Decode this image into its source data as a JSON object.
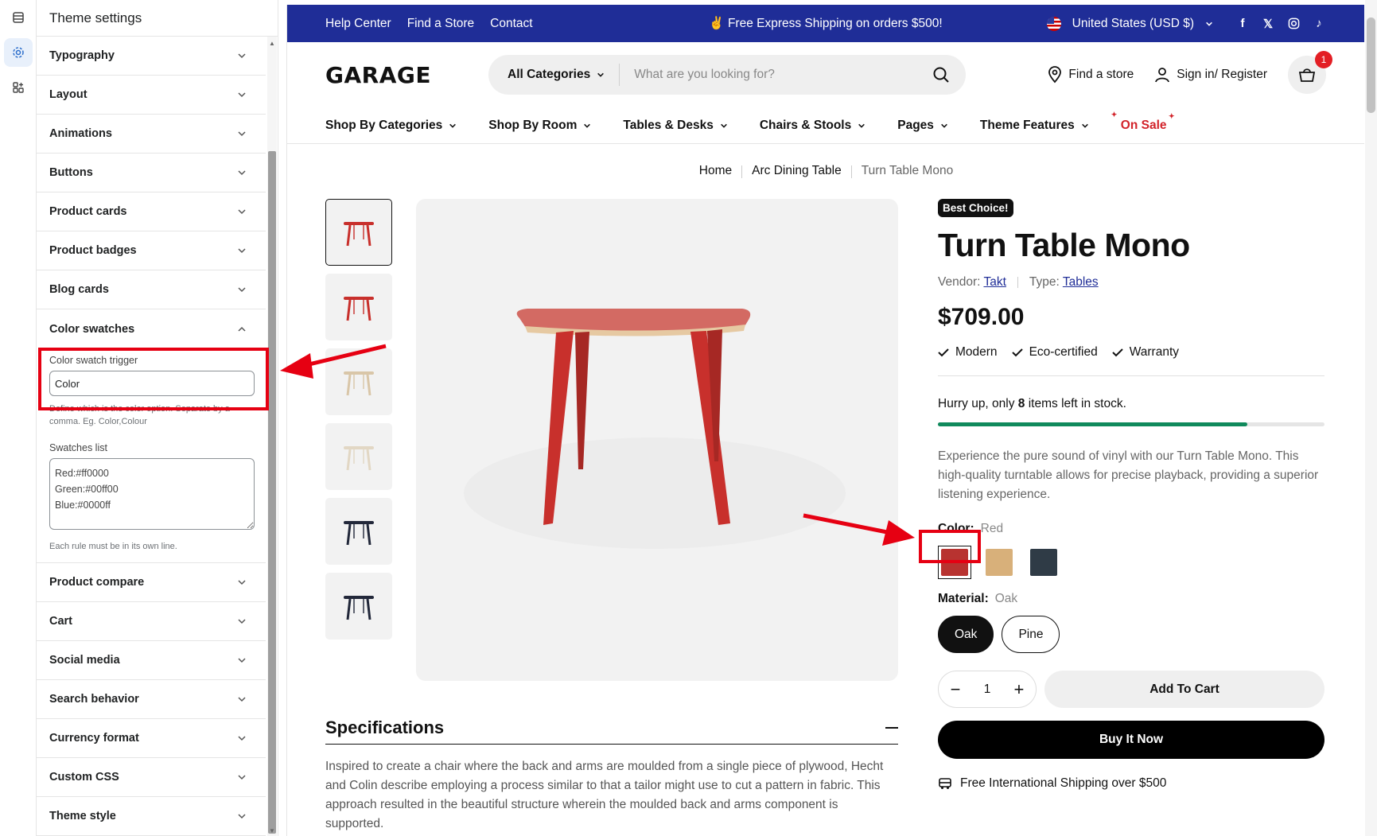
{
  "rail": {
    "icons": [
      "sections-icon",
      "settings-gear-icon",
      "apps-icon"
    ]
  },
  "panel": {
    "title": "Theme settings",
    "sections_top": [
      "Typography",
      "Layout",
      "Animations",
      "Buttons",
      "Product cards",
      "Product badges",
      "Blog cards"
    ],
    "open_section": {
      "label": "Color swatches",
      "trigger_label": "Color swatch trigger",
      "trigger_value": "Color",
      "trigger_help": "Define which is the color option. Separate by a comma. Eg. Color,Colour",
      "list_label": "Swatches list",
      "list_value": "Red:#ff0000\nGreen:#00ff00\nBlue:#0000ff",
      "list_help": "Each rule must be in its own line."
    },
    "sections_bottom": [
      "Product compare",
      "Cart",
      "Social media",
      "Search behavior",
      "Currency format",
      "Custom CSS",
      "Theme style"
    ]
  },
  "announce": {
    "links": [
      "Help Center",
      "Find a Store",
      "Contact"
    ],
    "promo": "✌️ Free Express Shipping on orders $500!",
    "currency": "United States (USD $)",
    "social_icons": [
      "facebook-icon",
      "x-icon",
      "instagram-icon",
      "tiktok-icon"
    ]
  },
  "header": {
    "logo": "GARAGE",
    "search_category": "All Categories",
    "search_placeholder": "What are you looking for?",
    "find_store": "Find a store",
    "sign_in": "Sign in/ Register",
    "cart_count": "1"
  },
  "nav": {
    "items": [
      "Shop By Categories",
      "Shop By Room",
      "Tables & Desks",
      "Chairs & Stools",
      "Pages",
      "Theme Features"
    ],
    "sale": "On Sale"
  },
  "breadcrumb": [
    "Home",
    "Arc Dining Table",
    "Turn Table Mono"
  ],
  "product": {
    "badge": "Best Choice!",
    "title": "Turn Table Mono",
    "vendor_label": "Vendor:",
    "vendor": "Takt",
    "type_label": "Type:",
    "type": "Tables",
    "price": "$709.00",
    "perks": [
      "Modern",
      "Eco-certified",
      "Warranty"
    ],
    "stock_prefix": "Hurry up, only ",
    "stock_count": "8",
    "stock_suffix": " items left in stock.",
    "stock_fill_fraction": 0.8,
    "description": "Experience the pure sound of vinyl with our Turn Table Mono. This high-quality turntable allows for precise playback, providing a superior listening experience.",
    "color_label": "Color:",
    "color_value": "Red",
    "swatch_colors": [
      "#b83330",
      "#d8b07a",
      "#2f3b46"
    ],
    "material_label": "Material:",
    "material_value": "Oak",
    "materials": [
      "Oak",
      "Pine"
    ],
    "quantity": "1",
    "add_to_cart": "Add To Cart",
    "buy_now": "Buy It Now",
    "shipping": "Free International Shipping over $500"
  },
  "specs": {
    "title": "Specifications",
    "body": "Inspired to create a chair where the back and arms are moulded from a single piece of plywood, Hecht and Colin describe employing a process similar to that a tailor might use to cut a pattern in fabric. This approach resulted in the beautiful structure wherein the moulded back and arms component is supported."
  },
  "colors": {
    "accent_blue": "#1f2d97",
    "sale_red": "#d2232a",
    "annotation_red": "#e60012",
    "stock_green": "#108a5c"
  }
}
